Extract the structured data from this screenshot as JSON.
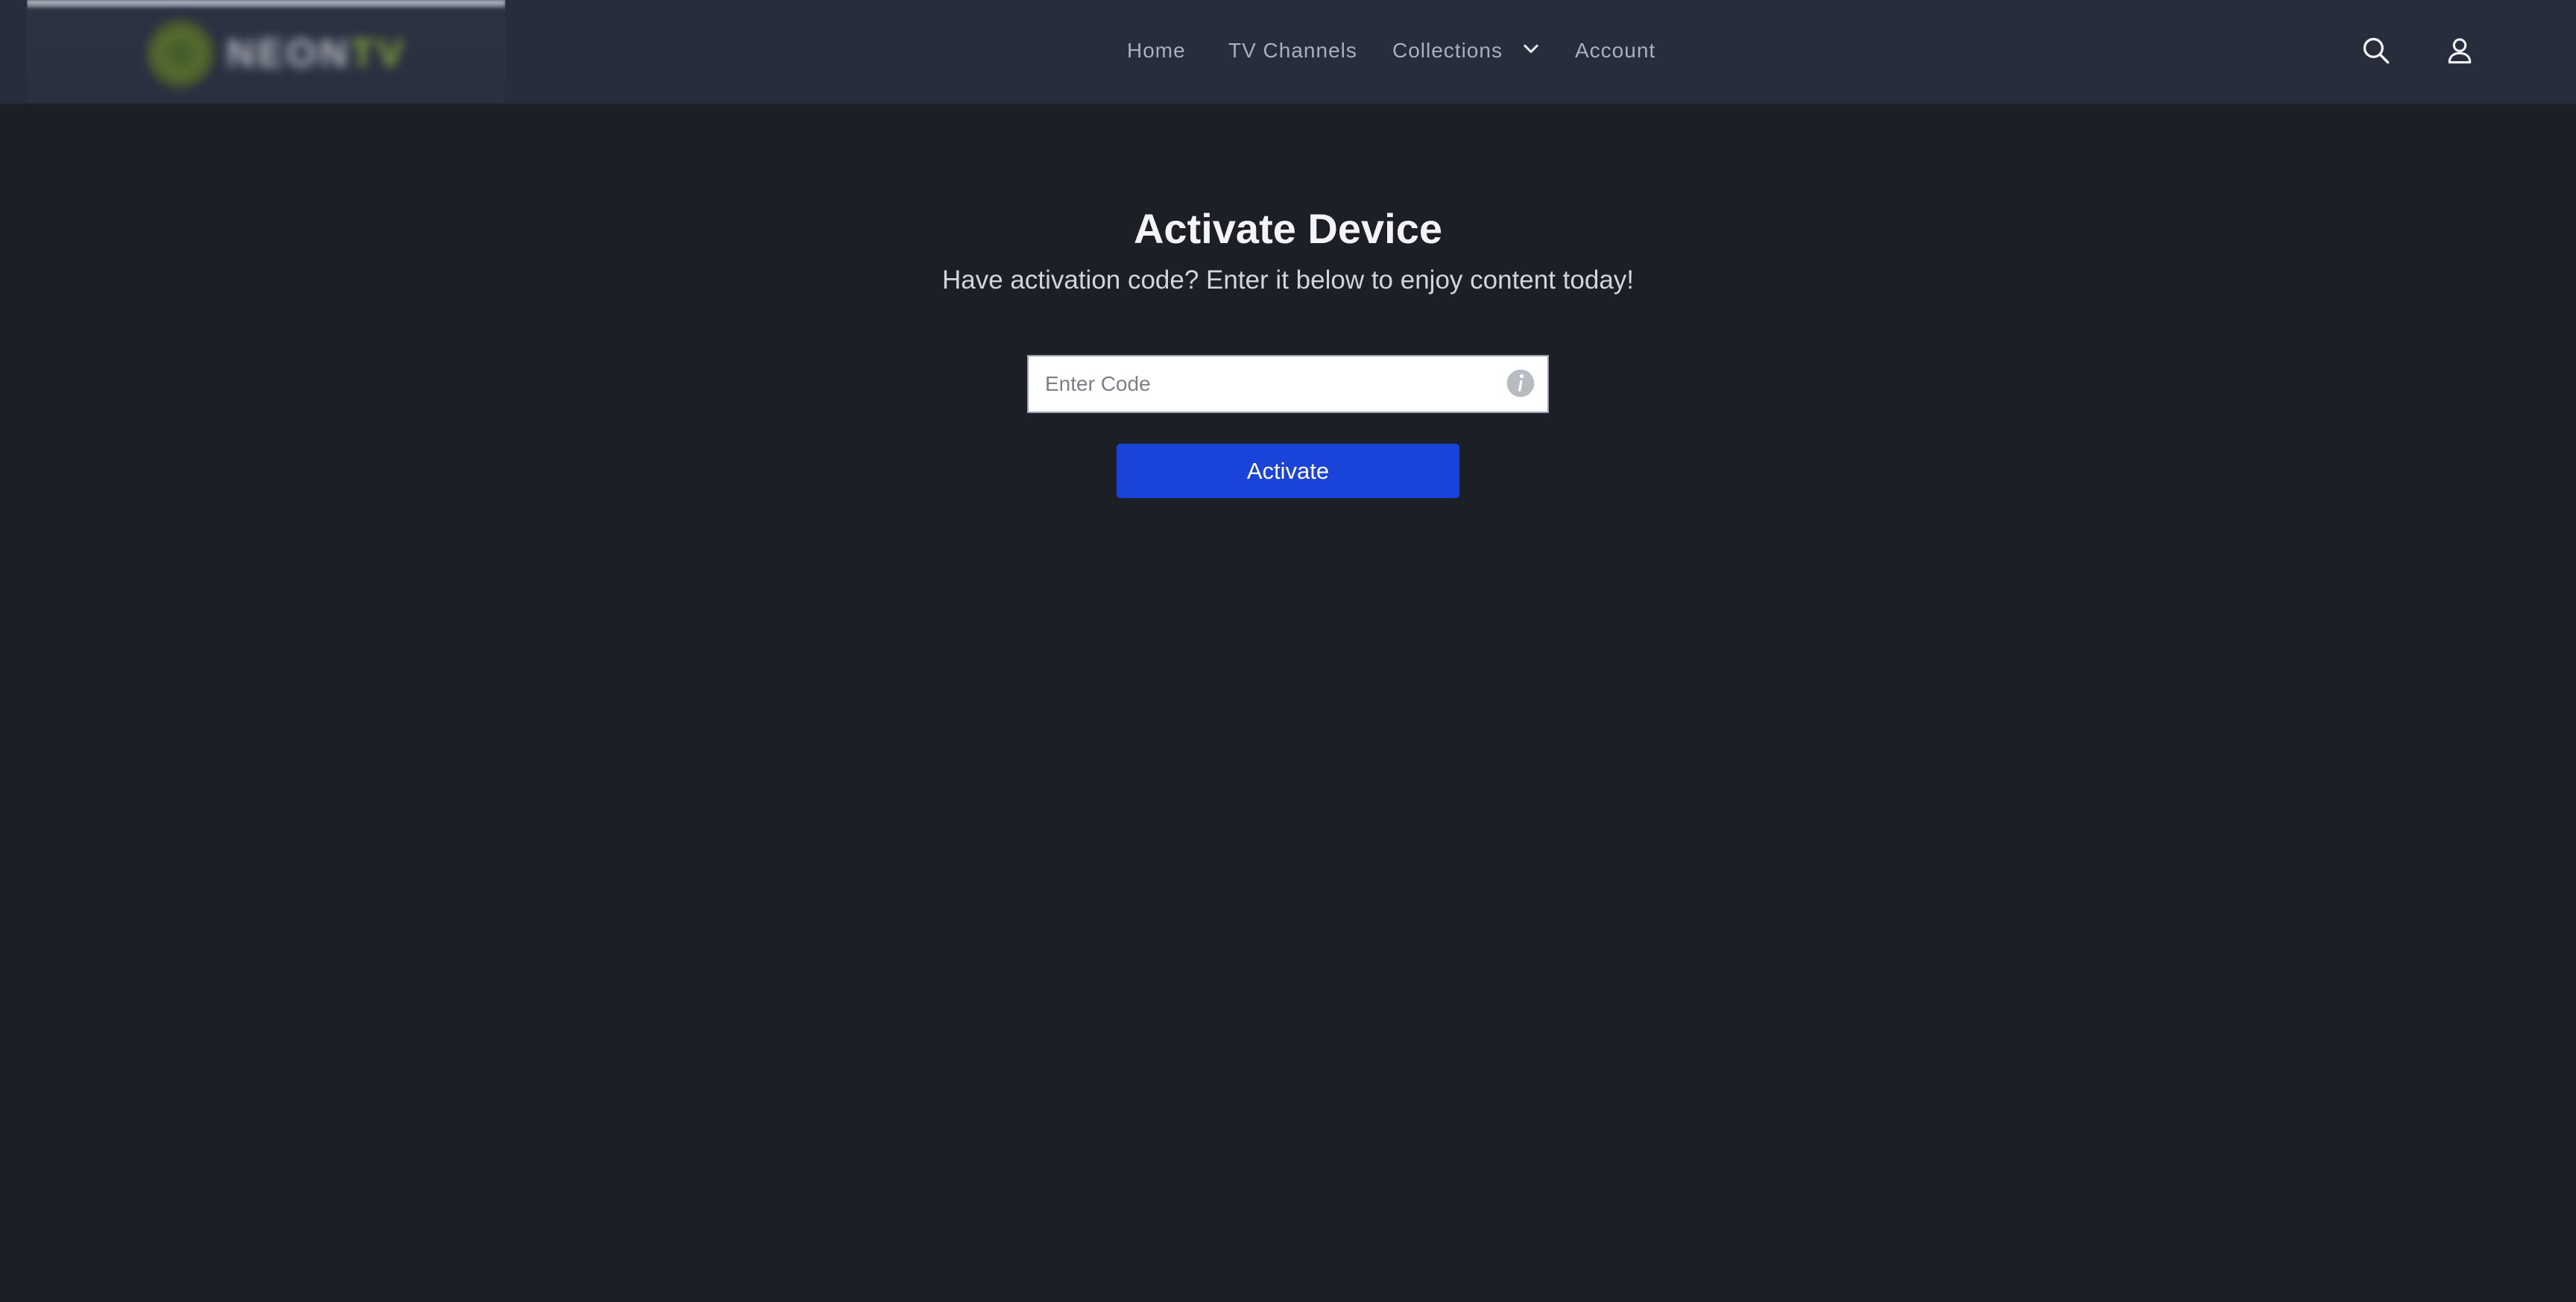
{
  "header": {
    "logo": {
      "text": "NEON",
      "accent_text": "TV",
      "accent_color": "#86a83a"
    },
    "nav": [
      {
        "label": "Home"
      },
      {
        "label": "TV Channels"
      },
      {
        "label": "Collections"
      },
      {
        "label": "Account"
      }
    ],
    "icons": {
      "collections_dropdown": "chevron-down-icon",
      "search": "search-icon",
      "account": "user-icon"
    }
  },
  "main": {
    "title": "Activate Device",
    "subtitle": "Have activation code? Enter it below to enjoy content today!",
    "code_input": {
      "placeholder": "Enter Code",
      "value": ""
    },
    "info_icon": "info-icon",
    "activate_label": "Activate"
  },
  "colors": {
    "background": "#1d1f26",
    "header_background": "#282d3b",
    "button_primary": "#1a43d9",
    "nav_text": "#a9afbd"
  }
}
